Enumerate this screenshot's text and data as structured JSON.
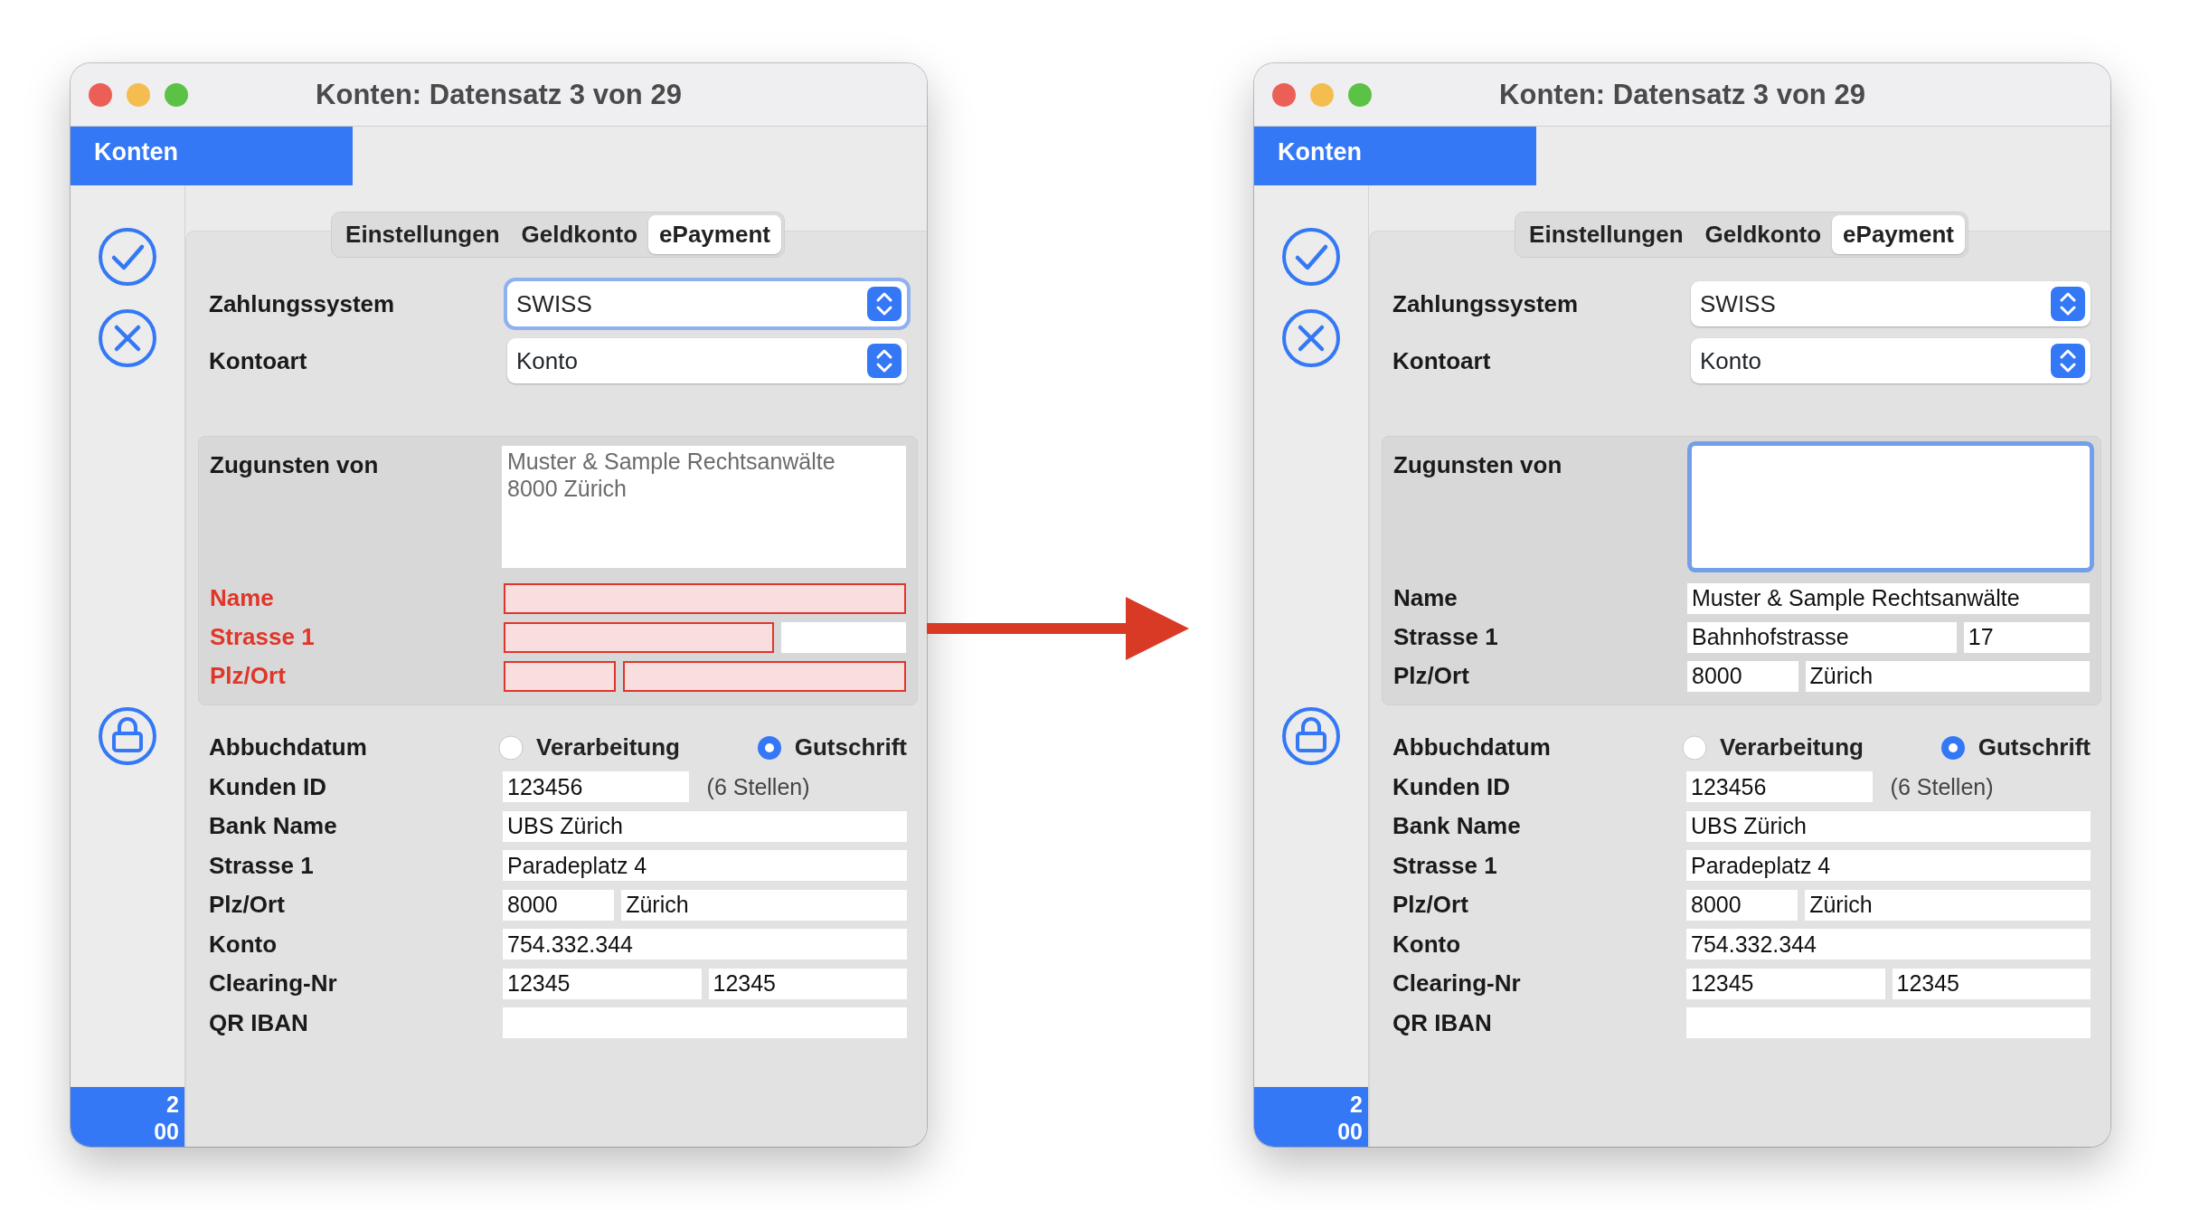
{
  "windows": [
    {
      "title": "Konten: Datensatz 3 von 29",
      "section_tab": "Konten",
      "footer_counter": [
        "2",
        "00"
      ],
      "tabs": [
        {
          "label": "Einstellungen",
          "selected": false
        },
        {
          "label": "Geldkonto",
          "selected": false
        },
        {
          "label": "ePayment",
          "selected": true
        }
      ],
      "selects": [
        {
          "label": "Zahlungssystem",
          "value": "SWISS",
          "focused": true
        },
        {
          "label": "Kontoart",
          "value": "Konto",
          "focused": false
        }
      ],
      "beneficiary": {
        "label": "Zugunsten von",
        "placeholder": "Muster & Sample Rechtsanwälte\n8000 Zürich",
        "focused": false,
        "rows": [
          {
            "kind": "single",
            "label": "Name",
            "invalid": true,
            "inputs": [
              {
                "invalid": true
              }
            ]
          },
          {
            "kind": "street",
            "label": "Strasse 1",
            "invalid": true,
            "inputs": [
              {
                "invalid": true
              },
              {
                "invalid": false
              }
            ]
          },
          {
            "kind": "postcode",
            "label": "Plz/Ort",
            "invalid": true,
            "inputs": [
              {
                "invalid": true
              },
              {
                "invalid": true
              }
            ]
          }
        ]
      },
      "rows": [
        {
          "kind": "radio",
          "label": "Abbuchdatum",
          "options": [
            {
              "label": "Verarbeitung",
              "selected": false
            },
            {
              "label": "Gutschrift",
              "selected": true
            }
          ]
        },
        {
          "kind": "note",
          "label": "Kunden ID",
          "inputs": [
            {
              "value": "123456"
            }
          ],
          "note": "(6 Stellen)"
        },
        {
          "kind": "single",
          "label": "Bank Name",
          "inputs": [
            {
              "value": "UBS Zürich"
            }
          ]
        },
        {
          "kind": "single",
          "label": "Strasse 1",
          "inputs": [
            {
              "value": "Paradeplatz 4"
            }
          ]
        },
        {
          "kind": "postcode",
          "label": "Plz/Ort",
          "inputs": [
            {
              "value": "8000"
            },
            {
              "value": "Zürich"
            }
          ]
        },
        {
          "kind": "single",
          "label": "Konto",
          "inputs": [
            {
              "value": "754.332.344"
            }
          ]
        },
        {
          "kind": "halves",
          "label": "Clearing-Nr",
          "inputs": [
            {
              "value": "12345"
            },
            {
              "value": "12345"
            }
          ]
        },
        {
          "kind": "single",
          "label": "QR IBAN"
        }
      ]
    },
    {
      "title": "Konten: Datensatz 3 von 29",
      "section_tab": "Konten",
      "footer_counter": [
        "2",
        "00"
      ],
      "tabs": [
        {
          "label": "Einstellungen",
          "selected": false
        },
        {
          "label": "Geldkonto",
          "selected": false
        },
        {
          "label": "ePayment",
          "selected": true
        }
      ],
      "selects": [
        {
          "label": "Zahlungssystem",
          "value": "SWISS",
          "focused": false
        },
        {
          "label": "Kontoart",
          "value": "Konto",
          "focused": false
        }
      ],
      "beneficiary": {
        "label": "Zugunsten von",
        "focused": true,
        "rows": [
          {
            "kind": "single",
            "label": "Name",
            "invalid": false,
            "inputs": [
              {
                "value": "Muster & Sample Rechtsanwälte",
                "invalid": false
              }
            ]
          },
          {
            "kind": "street",
            "label": "Strasse 1",
            "invalid": false,
            "inputs": [
              {
                "value": "Bahnhofstrasse",
                "invalid": false
              },
              {
                "value": "17",
                "invalid": false
              }
            ]
          },
          {
            "kind": "postcode",
            "label": "Plz/Ort",
            "invalid": false,
            "inputs": [
              {
                "value": "8000",
                "invalid": false
              },
              {
                "value": "Zürich",
                "invalid": false
              }
            ]
          }
        ]
      },
      "rows": [
        {
          "kind": "radio",
          "label": "Abbuchdatum",
          "options": [
            {
              "label": "Verarbeitung",
              "selected": false
            },
            {
              "label": "Gutschrift",
              "selected": true
            }
          ]
        },
        {
          "kind": "note",
          "label": "Kunden ID",
          "inputs": [
            {
              "value": "123456"
            }
          ],
          "note": "(6 Stellen)"
        },
        {
          "kind": "single",
          "label": "Bank Name",
          "inputs": [
            {
              "value": "UBS Zürich"
            }
          ]
        },
        {
          "kind": "single",
          "label": "Strasse 1",
          "inputs": [
            {
              "value": "Paradeplatz 4"
            }
          ]
        },
        {
          "kind": "postcode",
          "label": "Plz/Ort",
          "inputs": [
            {
              "value": "8000"
            },
            {
              "value": "Zürich"
            }
          ]
        },
        {
          "kind": "single",
          "label": "Konto",
          "inputs": [
            {
              "value": "754.332.344"
            }
          ]
        },
        {
          "kind": "halves",
          "label": "Clearing-Nr",
          "inputs": [
            {
              "value": "12345"
            },
            {
              "value": "12345"
            }
          ]
        },
        {
          "kind": "single",
          "label": "QR IBAN"
        }
      ]
    }
  ]
}
